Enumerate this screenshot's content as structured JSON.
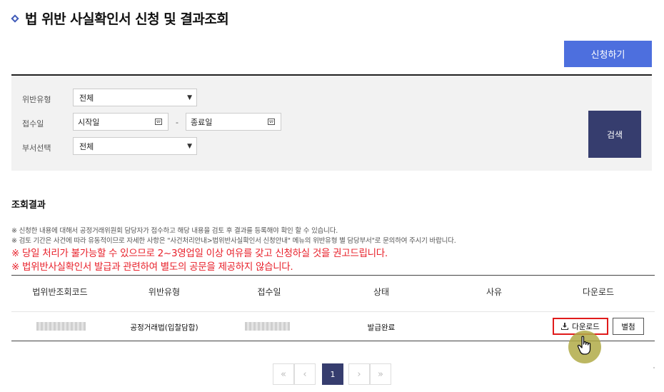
{
  "page": {
    "title": "법 위반 사실확인서 신청 및 결과조회",
    "apply_button": "신청하기"
  },
  "search": {
    "violation_type_label": "위반유형",
    "violation_type_value": "전체",
    "receipt_date_label": "접수일",
    "start_date_placeholder": "시작일",
    "date_separator": "-",
    "end_date_placeholder": "종료일",
    "department_label": "부서선택",
    "department_value": "전체",
    "search_button": "검색"
  },
  "results": {
    "heading": "조회결과",
    "notes": [
      "※ 신청한 내용에 대해서 공정거래위원회 담당자가 접수하고 해당 내용을 검토 후 결과를 등록해야 확인 할 수 있습니다.",
      "※ 검토 기간은 사건에 따라 유동적이므로 자세한 사항은 \"사건처리안내>법위반사실확인서 신청안내\" 메뉴의 위반유형 별 담당부서\"로 문의하여 주시기 바랍니다."
    ],
    "warnings": [
      "※ 당일 처리가 불가능할 수 있으므로 2~3영업일 이상 여유를 갖고 신청하실 것을 권고드립니다.",
      "※ 법위반사실확인서 발급과 관련하여 별도의 공문을 제공하지 않습니다."
    ]
  },
  "table": {
    "headers": [
      "법위반조회코드",
      "위반유형",
      "접수일",
      "상태",
      "사유",
      "다운로드"
    ],
    "rows": [
      {
        "violation_type": "공정거래법(입찰담합)",
        "status": "발급완료",
        "download_label": "다운로드",
        "annex_label": "별첨"
      }
    ]
  },
  "pagination": {
    "first": "«",
    "prev": "‹",
    "current": "1",
    "next": "›",
    "last": "»"
  },
  "colors": {
    "primary_button": "#4d6fde",
    "dark_navy": "#363d6e",
    "warning_red": "#e8202a",
    "highlight_red": "#e01b1b",
    "cursor_halo": "#b0aa46"
  },
  "icons": {
    "title_marker": "diamond-icon",
    "calendar": "calendar-icon",
    "download": "download-icon",
    "cursor": "hand-pointer-icon"
  }
}
